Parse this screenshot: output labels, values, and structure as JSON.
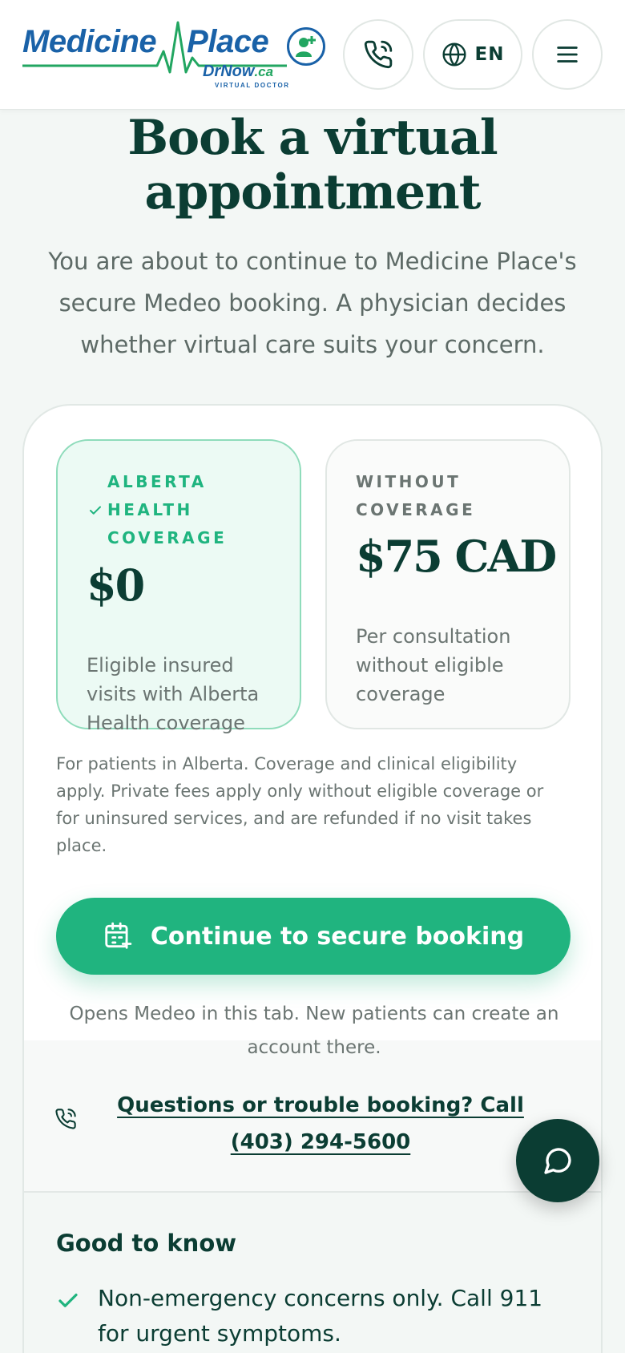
{
  "header": {
    "logo_name": "Medicine Place",
    "logo_name_part1": "Medicine",
    "logo_name_part2": "Place",
    "logo_sub": "DrNow",
    "logo_sub_tld": ".ca",
    "logo_tag": "VIRTUAL DOCTOR",
    "language": "EN",
    "icons": {
      "phone": "phone-icon",
      "language": "globe-icon",
      "menu": "hamburger-menu-icon"
    }
  },
  "hero": {
    "title": "Book a virtual appointment",
    "subtitle": "You are about to continue to Medicine Place's secure Medeo booking. A physician decides whether virtual care suits your concern."
  },
  "pricing": {
    "covered": {
      "label": "ALBERTA HEALTH COVERAGE",
      "amount": "$0",
      "description": "Eligible insured visits with Alberta Health coverage"
    },
    "uncovered": {
      "label": "WITHOUT COVERAGE",
      "amount": "$75 CAD",
      "description": "Per consultation without eligible coverage"
    },
    "fine_print": "For patients in Alberta. Coverage and clinical eligibility apply. Private fees apply only without eligible coverage or for uninsured services, and are refunded if no visit takes place."
  },
  "cta": {
    "label": "Continue to secure booking",
    "note": "Opens Medeo in this tab. New patients can create an account there."
  },
  "help": {
    "link_text": "Questions or trouble booking? Call (403) 294-5600"
  },
  "good_to_know": {
    "title": "Good to know",
    "items": [
      "Non-emergency concerns only. Call 911 for urgent symptoms."
    ]
  },
  "colors": {
    "brand_dark": "#0b3d33",
    "accent_green": "#20b47f",
    "logo_blue": "#1a62a8",
    "logo_green": "#22a661"
  }
}
